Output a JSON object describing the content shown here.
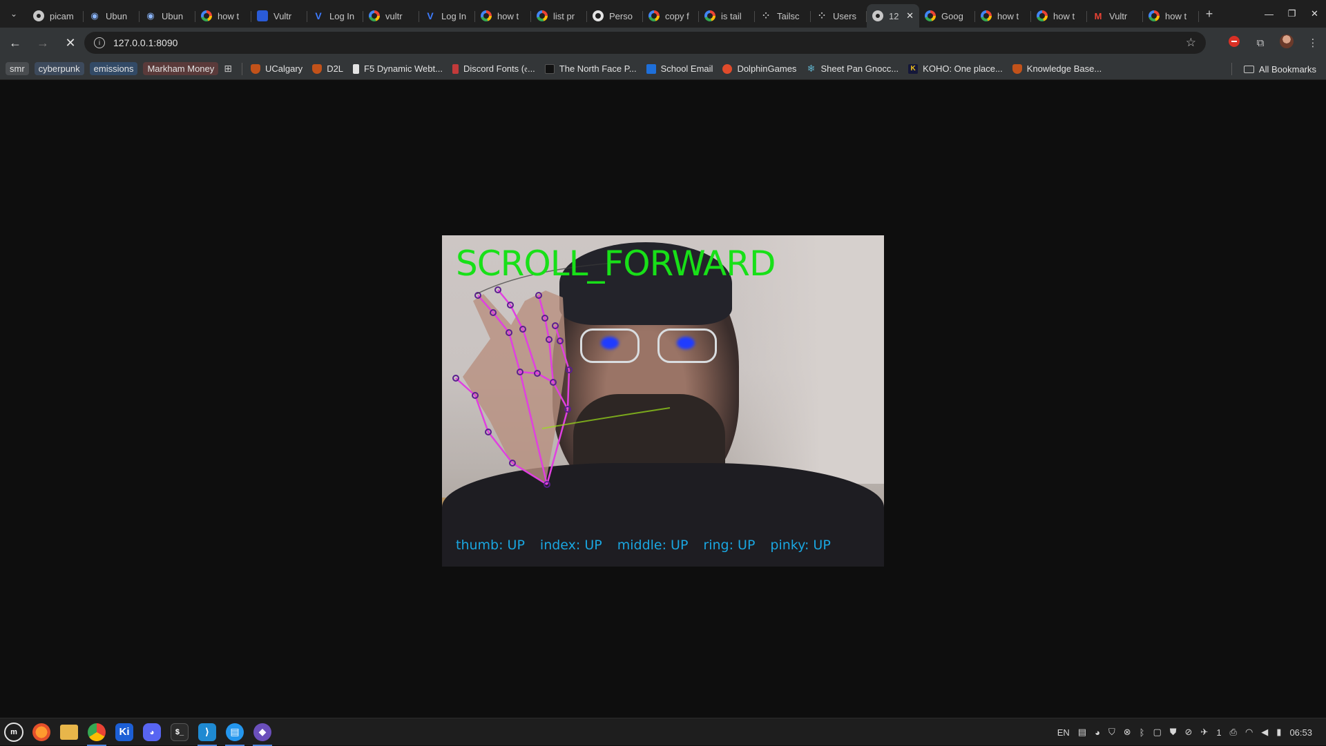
{
  "browser": {
    "tabs": [
      {
        "title": "picam",
        "icon": "circle-icon"
      },
      {
        "title": "Ubun",
        "icon": "ubuntu-icon"
      },
      {
        "title": "Ubun",
        "icon": "ubuntu-icon"
      },
      {
        "title": "how t",
        "icon": "google-icon"
      },
      {
        "title": "Vultr",
        "icon": "vultr-square-icon"
      },
      {
        "title": "Log In",
        "icon": "vultr-icon"
      },
      {
        "title": "vultr",
        "icon": "google-icon"
      },
      {
        "title": "Log In",
        "icon": "vultr-icon"
      },
      {
        "title": "how t",
        "icon": "google-icon"
      },
      {
        "title": "list pr",
        "icon": "google-icon"
      },
      {
        "title": "Perso",
        "icon": "github-icon"
      },
      {
        "title": "copy f",
        "icon": "google-icon"
      },
      {
        "title": "is tail",
        "icon": "google-icon"
      },
      {
        "title": "Tailsc",
        "icon": "tailscale-icon"
      },
      {
        "title": "Users",
        "icon": "tailscale-icon"
      },
      {
        "title": "12",
        "icon": "loading-icon",
        "active": true
      },
      {
        "title": "Goog",
        "icon": "google-icon"
      },
      {
        "title": "how t",
        "icon": "google-icon"
      },
      {
        "title": "how t",
        "icon": "google-icon"
      },
      {
        "title": "Vultr",
        "icon": "gmail-icon"
      },
      {
        "title": "how t",
        "icon": "google-icon"
      }
    ],
    "url": "127.0.0.1:8090",
    "bookmarks_chips": [
      "smr",
      "cyberpunk",
      "emissions",
      "Markham Money"
    ],
    "bookmarks": [
      {
        "label": "UCalgary",
        "icon": "shield-icon"
      },
      {
        "label": "D2L",
        "icon": "shield-icon"
      },
      {
        "label": "F5 Dynamic Webt...",
        "icon": "doc-icon"
      },
      {
        "label": "Discord Fonts (𝔢...",
        "icon": "font-icon"
      },
      {
        "label": "The North Face P...",
        "icon": "tnf-icon"
      },
      {
        "label": "School Email",
        "icon": "outlook-icon"
      },
      {
        "label": "DolphinGames",
        "icon": "dolphin-icon"
      },
      {
        "label": "Sheet Pan Gnocc...",
        "icon": "snowflake-icon"
      },
      {
        "label": "KOHO: One place...",
        "icon": "koho-icon"
      },
      {
        "label": "Knowledge Base...",
        "icon": "shield-icon"
      }
    ],
    "all_bookmarks": "All Bookmarks"
  },
  "video": {
    "gesture": "SCROLL_FORWARD",
    "fingers": [
      {
        "name": "thumb",
        "state": "UP"
      },
      {
        "name": "index",
        "state": "UP"
      },
      {
        "name": "middle",
        "state": "UP"
      },
      {
        "name": "ring",
        "state": "UP"
      },
      {
        "name": "pinky",
        "state": "UP"
      }
    ],
    "gesture_color": "#18e018",
    "finger_text_color": "#1aa6e0",
    "landmark_color": "#e040e0"
  },
  "taskbar": {
    "apps": [
      "mint-menu-icon",
      "firefox-icon",
      "files-icon",
      "chrome-icon",
      "kicad-icon",
      "discord-icon",
      "terminal-icon",
      "vscode-icon",
      "docker-icon",
      "obsidian-icon"
    ],
    "tray_lang": "EN",
    "tray_count": "1",
    "clock": "06:53"
  }
}
